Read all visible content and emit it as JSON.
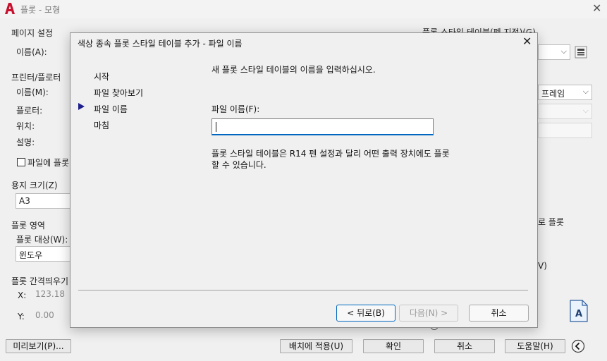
{
  "window": {
    "title": "플롯 - 모형"
  },
  "page_setup": {
    "group_title": "페이지 설정",
    "name_label": "이름(A):"
  },
  "plot_style_table": {
    "group_title": "플롯 스타일 테이블(펜 지정)(G)"
  },
  "printer": {
    "group_title": "프린터/플로터",
    "name_label": "이름(M):",
    "plotter_label": "플로터:",
    "location_label": "위치:",
    "description_label": "설명:",
    "plot_to_file_label": "파일에 플롯",
    "right_partial_select": "프레임",
    "right_partial_text": "로 플롯",
    "right_partial_v": "V)"
  },
  "paper_size": {
    "group_title": "용지 크기(Z)",
    "value": "A3"
  },
  "plot_area": {
    "group_title": "플롯 영역",
    "what_label": "플롯 대상(W):",
    "what_value": "윈도우"
  },
  "plot_offset": {
    "group_title": "플롯 간격띄우기",
    "x_label": "X:",
    "x_value": "123.18",
    "y_label": "Y:",
    "y_value": "0.00"
  },
  "bottom_buttons": {
    "preview": "미리보기(P)...",
    "apply_layout": "배치에 적용(U)",
    "ok": "확인",
    "cancel": "취소",
    "help": "도움말(H)"
  },
  "dialog": {
    "title": "색상 종속 플롯 스타일 테이블 추가 - 파일 이름",
    "steps": [
      "시작",
      "파일 찾아보기",
      "파일 이름",
      "마침"
    ],
    "current_step": "파일 이름",
    "intro": "새 플롯 스타일 테이블의 이름을 입력하십시오.",
    "file_name_label": "파일 이름(F):",
    "file_name_value": "",
    "note_line1": "플롯 스타일 테이블은 R14 펜 설정과 달리 어떤 출력 장치에도 플롯",
    "note_line2": "할 수 있습니다.",
    "back_button": "< 뒤로(B)",
    "next_button": "다음(N) >",
    "cancel_button": "취소"
  },
  "colors": {
    "accent": "#0067c0",
    "step_arrow": "#1e1e8c",
    "app_logo": "#c8102e"
  }
}
